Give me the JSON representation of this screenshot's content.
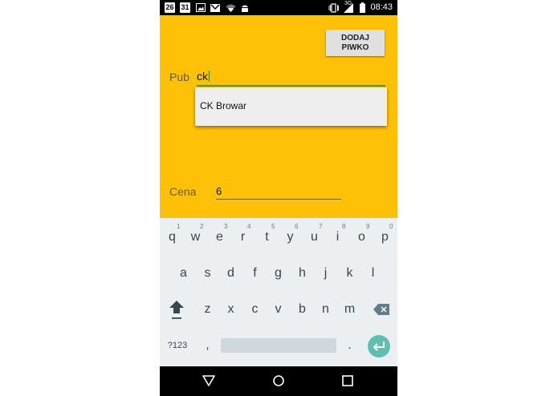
{
  "status_bar": {
    "icons": [
      "notification-26-icon",
      "calendar-31-icon",
      "image-icon",
      "gmail-icon",
      "wifi-icon",
      "android-debug-icon",
      "vibrate-icon",
      "signal-3g-icon",
      "battery-icon"
    ],
    "notif_num": "26",
    "calendar_day": "31",
    "network_label": "3G",
    "time": "08:43"
  },
  "form": {
    "add_button_line1": "DODAJ",
    "add_button_line2": "PIWKO",
    "pub_label": "Pub",
    "pub_value": "ck",
    "suggestion": "CK Browar",
    "price_label": "Cena",
    "price_value": "6"
  },
  "keyboard": {
    "row1": [
      "q",
      "w",
      "e",
      "r",
      "t",
      "y",
      "u",
      "i",
      "o",
      "p"
    ],
    "row1_numbers": [
      "1",
      "2",
      "3",
      "4",
      "5",
      "6",
      "7",
      "8",
      "9",
      "0"
    ],
    "row2": [
      "a",
      "s",
      "d",
      "f",
      "g",
      "h",
      "j",
      "k",
      "l"
    ],
    "row3": [
      "z",
      "x",
      "c",
      "v",
      "b",
      "n",
      "m"
    ],
    "symbols_key": "?123",
    "comma_key": ",",
    "period_key": "."
  },
  "colors": {
    "app_background": "#FFC107",
    "accent_green": "#43a047",
    "keyboard_background": "#eceff1",
    "enter_key": "#5ebfb0"
  }
}
